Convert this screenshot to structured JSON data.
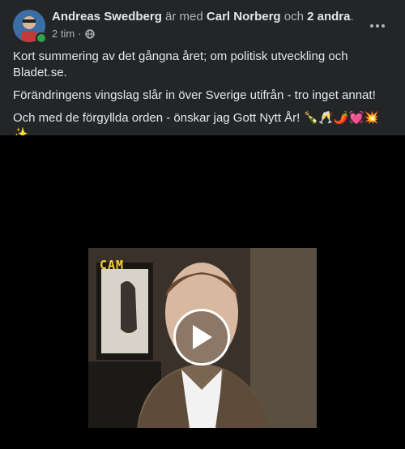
{
  "post": {
    "author": "Andreas Swedberg",
    "with_text": " är med ",
    "tagged_person": "Carl Norberg",
    "and_text": " och ",
    "others_text": "2 andra",
    "period": ".",
    "time": "2 tim",
    "separator": "·",
    "privacy_icon": "globe-icon",
    "more_icon": "more-horizontal-icon",
    "paragraphs": [
      "Kort summering av det gångna året; om politisk utveckling och Bladet.se.",
      "Förändringens vingslag slår in över Sverige utifrån - tro inget annat!",
      "Och med de förgyllda orden - önskar jag Gott Nytt År! 🍾🥂🌶️💓💥✨"
    ]
  },
  "video": {
    "overlay_label": "CAM",
    "play_icon": "play-icon"
  },
  "colors": {
    "background": "#242526",
    "text": "#e4e6eb",
    "muted": "#b0b3b8",
    "online": "#31a24c",
    "cam_label": "#f4d13a"
  }
}
